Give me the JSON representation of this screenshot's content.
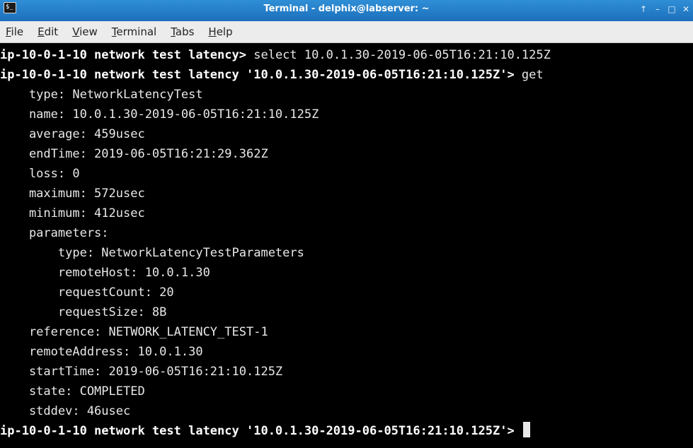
{
  "window": {
    "title": "Terminal - delphix@labserver: ~",
    "icon": "terminal-icon",
    "controls": [
      "pin-icon",
      "minimize-icon",
      "maximize-icon",
      "close-icon"
    ]
  },
  "menu": [
    "File",
    "Edit",
    "View",
    "Terminal",
    "Tabs",
    "Help"
  ],
  "terminal": {
    "lines": [
      {
        "prompt": "ip-10-0-1-10 network test latency> ",
        "text": "select 10.0.1.30-2019-06-05T16:21:10.125Z"
      },
      {
        "prompt": "ip-10-0-1-10 network test latency '10.0.1.30-2019-06-05T16:21:10.125Z'> ",
        "text": "get"
      },
      {
        "prompt": "",
        "text": "    type: NetworkLatencyTest"
      },
      {
        "prompt": "",
        "text": "    name: 10.0.1.30-2019-06-05T16:21:10.125Z"
      },
      {
        "prompt": "",
        "text": "    average: 459usec"
      },
      {
        "prompt": "",
        "text": "    endTime: 2019-06-05T16:21:29.362Z"
      },
      {
        "prompt": "",
        "text": "    loss: 0"
      },
      {
        "prompt": "",
        "text": "    maximum: 572usec"
      },
      {
        "prompt": "",
        "text": "    minimum: 412usec"
      },
      {
        "prompt": "",
        "text": "    parameters:"
      },
      {
        "prompt": "",
        "text": "        type: NetworkLatencyTestParameters"
      },
      {
        "prompt": "",
        "text": "        remoteHost: 10.0.1.30"
      },
      {
        "prompt": "",
        "text": "        requestCount: 20"
      },
      {
        "prompt": "",
        "text": "        requestSize: 8B"
      },
      {
        "prompt": "",
        "text": "    reference: NETWORK_LATENCY_TEST-1"
      },
      {
        "prompt": "",
        "text": "    remoteAddress: 10.0.1.30"
      },
      {
        "prompt": "",
        "text": "    startTime: 2019-06-05T16:21:10.125Z"
      },
      {
        "prompt": "",
        "text": "    state: COMPLETED"
      },
      {
        "prompt": "",
        "text": "    stddev: 46usec"
      },
      {
        "prompt": "ip-10-0-1-10 network test latency '10.0.1.30-2019-06-05T16:21:10.125Z'> ",
        "text": ""
      }
    ]
  }
}
